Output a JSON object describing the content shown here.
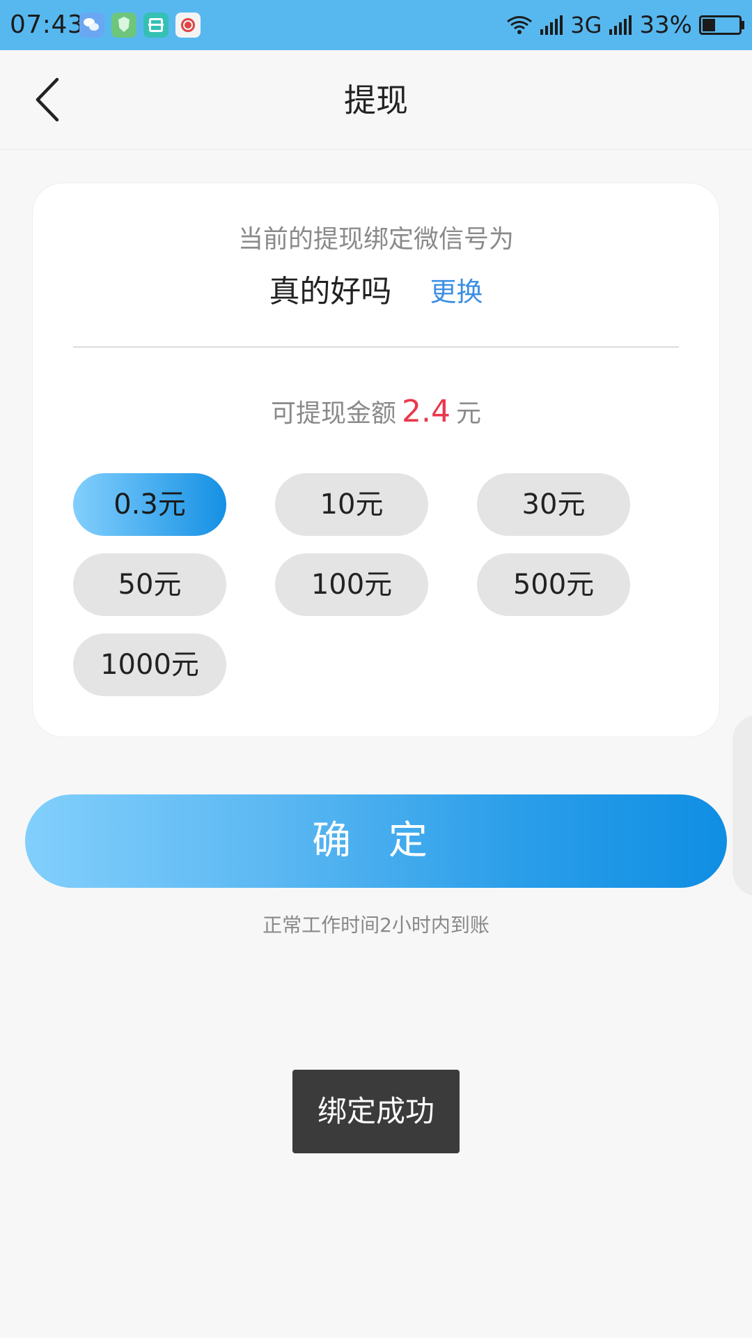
{
  "status_bar": {
    "time": "07:43",
    "network": "3G",
    "battery": "33%",
    "app_icons": [
      "wechat-icon",
      "shield-icon",
      "scan-icon",
      "weibo-icon"
    ]
  },
  "header": {
    "title": "提现",
    "back_icon": "chevron-left-icon"
  },
  "account": {
    "label": "当前的提现绑定微信号为",
    "name": "真的好吗",
    "change_label": "更换"
  },
  "balance": {
    "prefix": "可提现金额",
    "value": "2.4",
    "unit": "元"
  },
  "options": [
    {
      "label": "0.3元",
      "selected": true
    },
    {
      "label": "10元",
      "selected": false
    },
    {
      "label": "30元",
      "selected": false
    },
    {
      "label": "50元",
      "selected": false
    },
    {
      "label": "100元",
      "selected": false
    },
    {
      "label": "500元",
      "selected": false
    },
    {
      "label": "1000元",
      "selected": false
    }
  ],
  "confirm_label": "确 定",
  "hint": "正常工作时间2小时内到账",
  "toast": "绑定成功",
  "colors": {
    "status_bar": "#57b8ef",
    "accent_start": "#82cffc",
    "accent_end": "#0f8ee3",
    "amount": "#e8394d",
    "link": "#3c8fe3"
  }
}
